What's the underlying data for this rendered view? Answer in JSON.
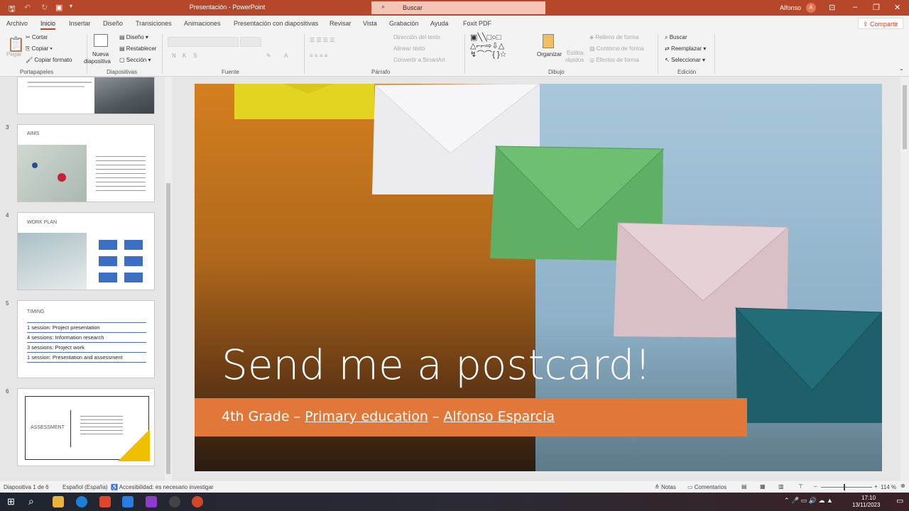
{
  "window": {
    "title": "Presentación - PowerPoint",
    "search_placeholder": "Buscar",
    "user": "Alfonso",
    "avatar_initial": "A"
  },
  "tabs": [
    "Archivo",
    "Inicio",
    "Insertar",
    "Diseño",
    "Transiciones",
    "Animaciones",
    "Presentación con diapositivas",
    "Revisar",
    "Vista",
    "Grabación",
    "Ayuda",
    "Foxit PDF"
  ],
  "active_tab": "Inicio",
  "share_label": "Compartir",
  "ribbon": {
    "portapapeles": {
      "paste": "Pegar",
      "cut": "Cortar",
      "copy": "Copiar",
      "format": "Copiar formato",
      "label": "Portapapeles"
    },
    "diapositivas": {
      "new": "Nueva",
      "new2": "diapositiva",
      "layout": "Diseño",
      "reset": "Restablecer",
      "section": "Sección",
      "label": "Diapositivas"
    },
    "fuente": {
      "bold": "N",
      "italic": "K",
      "underline": "S",
      "label": "Fuente"
    },
    "parrafo": {
      "direction": "Dirección del texto",
      "align": "Alinear texto",
      "smartart": "Convertir a SmartArt",
      "label": "Párrafo"
    },
    "dibujo": {
      "arrange": "Organizar",
      "styles": "Estilos",
      "styles2": "rápidos",
      "fill": "Relleno de forma",
      "outline": "Contorno de forma",
      "effects": "Efectos de forma",
      "label": "Dibujo"
    },
    "edicion": {
      "find": "Buscar",
      "replace": "Reemplazar",
      "select": "Seleccionar",
      "label": "Edición"
    }
  },
  "thumbnails": [
    {
      "num": "3",
      "title": "AIMS"
    },
    {
      "num": "4",
      "title": "WORK PLAN"
    },
    {
      "num": "5",
      "title": "TIMING",
      "lines": [
        "1 session: Project presentation",
        "4 sessions: Information research",
        "3 sessions: Project work",
        "1 session: Presentation and assessment"
      ]
    },
    {
      "num": "6",
      "title": "ASSESSMENT"
    }
  ],
  "slide": {
    "title": "Send me a postcard!",
    "subtitle_pre": "4th Grade – ",
    "subtitle_link1": "Primary education",
    "subtitle_mid": " – ",
    "subtitle_link2": "Alfonso Esparcia",
    "colors": {
      "band": "#e17738"
    }
  },
  "status": {
    "slide": "Diapositiva 1 de 6",
    "language": "Español (España)",
    "accessibility": "Accesibilidad: es necesario investigar",
    "notes": "Notas",
    "comments": "Comentarios",
    "zoom": "114 %"
  },
  "taskbar": {
    "time": "17:10",
    "date": "13/11/2023"
  },
  "colors": {
    "accent": "#b7472a"
  }
}
